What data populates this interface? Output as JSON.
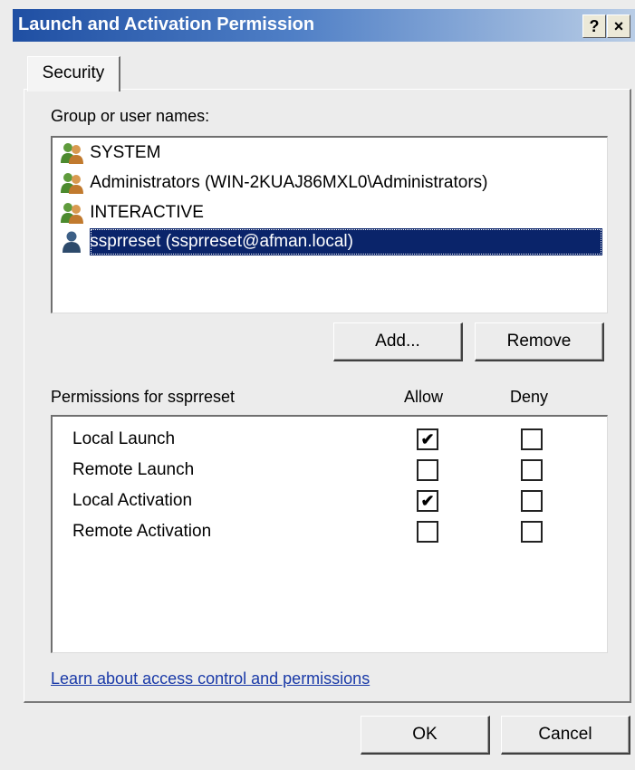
{
  "window": {
    "title": "Launch and Activation Permission",
    "help_glyph": "?",
    "close_glyph": "×"
  },
  "tabs": [
    {
      "label": "Security"
    }
  ],
  "groups": {
    "label": "Group or user names:",
    "items": [
      {
        "name": "SYSTEM",
        "icon": "group-icon",
        "selected": false
      },
      {
        "name": "Administrators (WIN-2KUAJ86MXL0\\Administrators)",
        "icon": "group-icon",
        "selected": false
      },
      {
        "name": "INTERACTIVE",
        "icon": "group-icon",
        "selected": false
      },
      {
        "name": "ssprreset (ssprreset@afman.local)",
        "icon": "user-icon",
        "selected": true
      }
    ],
    "add_label": "Add...",
    "remove_label": "Remove"
  },
  "permissions": {
    "label": "Permissions for ssprreset",
    "allow_header": "Allow",
    "deny_header": "Deny",
    "rows": [
      {
        "name": "Local Launch",
        "allow": true,
        "deny": false
      },
      {
        "name": "Remote Launch",
        "allow": false,
        "deny": false
      },
      {
        "name": "Local Activation",
        "allow": true,
        "deny": false
      },
      {
        "name": "Remote Activation",
        "allow": false,
        "deny": false
      }
    ]
  },
  "link_text": "Learn about access control and permissions",
  "footer": {
    "ok_label": "OK",
    "cancel_label": "Cancel"
  },
  "colors": {
    "selection": "#0a246a",
    "title_gradient_start": "#1f4fa3",
    "link": "#1a3aa8"
  }
}
